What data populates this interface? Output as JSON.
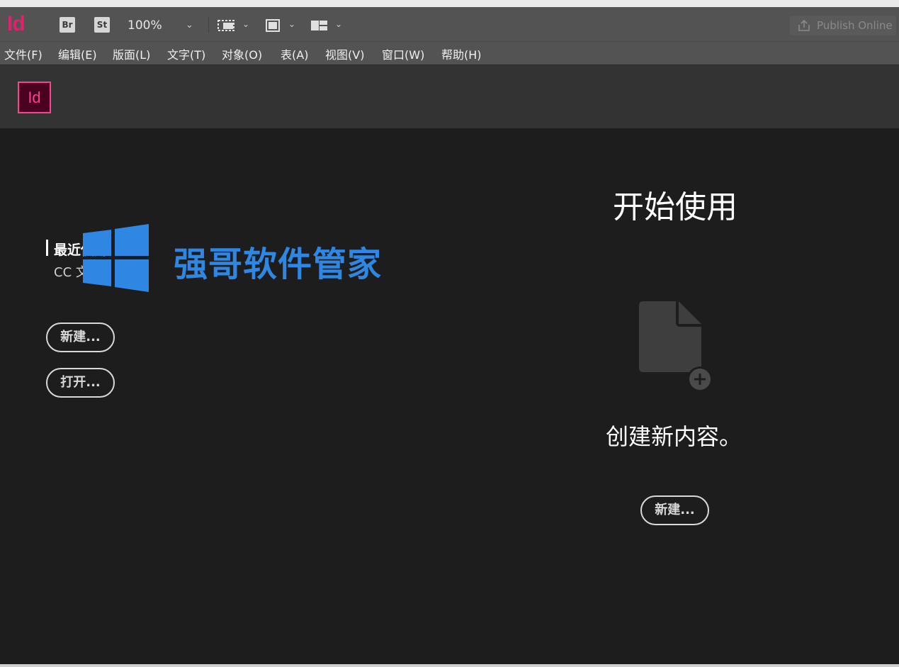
{
  "window": {
    "title": ""
  },
  "app_bar": {
    "logo_text": "Id",
    "bridge_label": "Br",
    "stock_label": "St",
    "zoom_value": "100%",
    "publish_label": "Publish Online"
  },
  "menubar": {
    "items": [
      {
        "label": "文件(F)"
      },
      {
        "label": "编辑(E)"
      },
      {
        "label": "版面(L)"
      },
      {
        "label": "文字(T)"
      },
      {
        "label": "对象(O)"
      },
      {
        "label": "表(A)"
      },
      {
        "label": "视图(V)"
      },
      {
        "label": "窗口(W)"
      },
      {
        "label": "帮助(H)"
      }
    ]
  },
  "home": {
    "badge_text": "Id",
    "recent_title": "最近使用",
    "cc_files": "CC 文件",
    "new_button": "新建...",
    "open_button": "打开...",
    "start_title": "开始使用",
    "create_text": "创建新内容。",
    "new_button_2": "新建..."
  },
  "watermark": {
    "text": "强哥软件管家"
  },
  "colors": {
    "accent": "#ff3f94",
    "logo": "#d8256b",
    "background": "#1d1d1d",
    "chrome": "#535353",
    "watermark": "#2f86e3"
  }
}
